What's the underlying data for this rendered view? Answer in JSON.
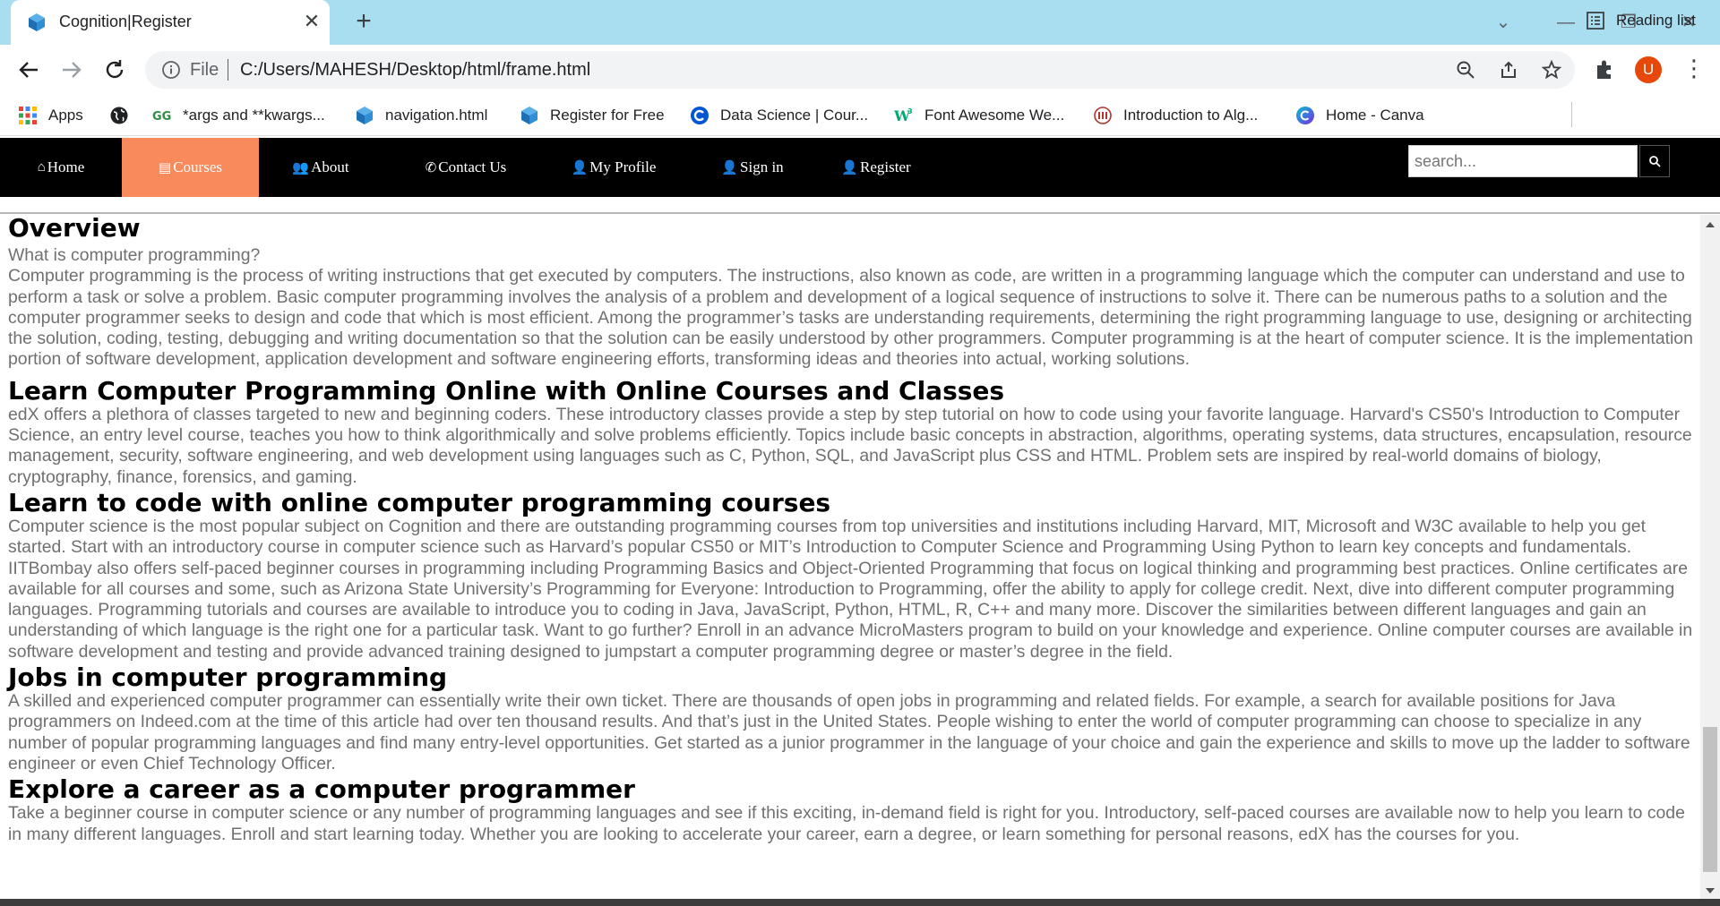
{
  "browser": {
    "tab": {
      "title": "Cognition|Register",
      "close_glyph": "✕"
    },
    "new_tab_glyph": "+",
    "window_controls": {
      "minimize": "—",
      "restore": "❐",
      "close": "✕",
      "tab_search": "⌄"
    },
    "omnibox": {
      "scheme_label": "File",
      "url": "C:/Users/MAHESH/Desktop/html/frame.html"
    },
    "profile_initial": "U",
    "menu_glyph": "⋮",
    "bookmarks": [
      {
        "label": "Apps",
        "icon": "apps-grid-icon"
      },
      {
        "label": "",
        "icon": "globe-icon"
      },
      {
        "label": "*args and **kwargs...",
        "icon": "geeksforgeeks-icon"
      },
      {
        "label": "navigation.html",
        "icon": "cube-icon"
      },
      {
        "label": "Register for Free",
        "icon": "cube-icon"
      },
      {
        "label": "Data Science | Cour...",
        "icon": "coursera-icon"
      },
      {
        "label": "Font Awesome We...",
        "icon": "w3schools-icon"
      },
      {
        "label": "Introduction to Alg...",
        "icon": "mit-icon"
      },
      {
        "label": "Home - Canva",
        "icon": "canva-icon"
      }
    ],
    "reading_list": "Reading list"
  },
  "nav": {
    "items": [
      {
        "label": "Home",
        "icon": "home-icon",
        "glyph": "⌂"
      },
      {
        "label": "Courses",
        "icon": "book-icon",
        "glyph": "▤",
        "active": true
      },
      {
        "label": "About",
        "icon": "users-icon",
        "glyph": "👥"
      },
      {
        "label": "Contact Us",
        "icon": "phone-icon",
        "glyph": "✆"
      },
      {
        "label": "My Profile",
        "icon": "user-icon",
        "glyph": "👤"
      },
      {
        "label": "Sign in",
        "icon": "user-plus-icon",
        "glyph": "👤"
      },
      {
        "label": "Register",
        "icon": "user-icon",
        "glyph": "👤"
      }
    ],
    "search_placeholder": "search...",
    "accent": "#f98a5b"
  },
  "content": {
    "overview_heading": "Overview",
    "overview_question": "What is computer programming?",
    "overview_text": "Computer programming is the process of writing instructions that get executed by computers. The instructions, also known as code, are written in a programming language which the computer can understand and use to perform a task or solve a problem. Basic computer programming involves the analysis of a problem and development of a logical sequence of instructions to solve it. There can be numerous paths to a solution and the computer programmer seeks to design and code that which is most efficient. Among the programmer’s tasks are understanding requirements, determining the right programming language to use, designing or architecting the solution, coding, testing, debugging and writing documentation so that the solution can be easily understood by other programmers. Computer programming is at the heart of computer science. It is the implementation portion of software development, application development and software engineering efforts, transforming ideas and theories into actual, working solutions.",
    "sections": [
      {
        "heading": "Learn Computer Programming Online with Online Courses and Classes",
        "text": "edX offers a plethora of classes targeted to new and beginning coders. These introductory classes provide a step by step tutorial on how to code using your favorite language. Harvard's CS50's Introduction to Computer Science, an entry level course, teaches you how to think algorithmically and solve problems efficiently. Topics include basic concepts in abstraction, algorithms, operating systems, data structures, encapsulation, resource management, security, software engineering, and web development using languages such as C, Python, SQL, and JavaScript plus CSS and HTML. Problem sets are inspired by real-world domains of biology, cryptography, finance, forensics, and gaming."
      },
      {
        "heading": "Learn to code with online computer programming courses",
        "text": "Computer science is the most popular subject on Cognition and there are outstanding programming courses from top universities and institutions including Harvard, MIT, Microsoft and W3C available to help you get started. Start with an introductory course in computer science such as Harvard’s popular CS50 or MIT’s Introduction to Computer Science and Programming Using Python to learn key concepts and fundamentals. IITBombay also offers self-paced beginner courses in programming including Programming Basics and Object-Oriented Programming that focus on logical thinking and programming best practices. Online certificates are available for all courses and some, such as Arizona State University’s Programming for Everyone: Introduction to Programming, offer the ability to apply for college credit. Next, dive into different computer programming languages. Programming tutorials and courses are available to introduce you to coding in Java, JavaScript, Python, HTML, R, C++ and many more. Discover the similarities between different languages and gain an understanding of which language is the right one for a particular task. Want to go further? Enroll in an advance MicroMasters program to build on your knowledge and experience. Online computer courses are available in software development and testing and provide advanced training designed to jumpstart a computer programming degree or master’s degree in the field."
      },
      {
        "heading": "Jobs in computer programming",
        "text": "A skilled and experienced computer programmer can essentially write their own ticket. There are thousands of open jobs in programming and related fields. For example, a search for available positions for Java programmers on Indeed.com at the time of this article had over ten thousand results. And that’s just in the United States. People wishing to enter the world of computer programming can choose to specialize in any number of popular programming languages and find many entry-level opportunities. Get started as a junior programmer in the language of your choice and gain the experience and skills to move up the ladder to software engineer or even Chief Technology Officer."
      },
      {
        "heading": "Explore a career as a computer programmer",
        "text": "Take a beginner course in computer science or any number of programming languages and see if this exciting, in-demand field is right for you. Introductory, self-paced courses are available now to help you learn to code in many different languages. Enroll and start learning today. Whether you are looking to accelerate your career, earn a degree, or learn something for personal reasons, edX has the courses for you."
      }
    ]
  }
}
